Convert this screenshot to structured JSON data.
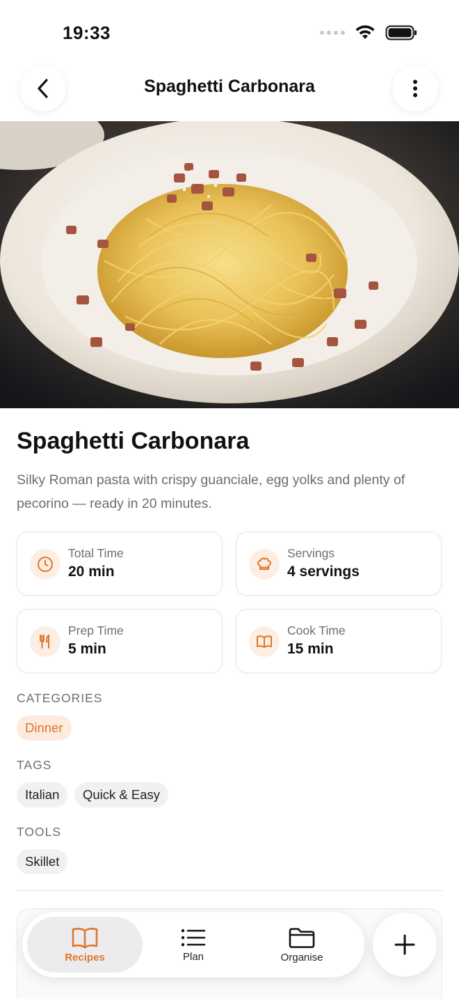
{
  "status_bar": {
    "time": "19:33"
  },
  "nav": {
    "title": "Spaghetti Carbonara"
  },
  "recipe": {
    "title": "Spaghetti Carbonara",
    "description": "Silky Roman pasta with crispy guanciale, egg yolks and plenty of pecorino — ready in 20 minutes."
  },
  "info": {
    "total_time": {
      "label": "Total Time",
      "value": "20 min"
    },
    "servings": {
      "label": "Servings",
      "value": "4 servings"
    },
    "prep_time": {
      "label": "Prep Time",
      "value": "5 min"
    },
    "cook_time": {
      "label": "Cook Time",
      "value": "15 min"
    }
  },
  "sections": {
    "categories": {
      "label": "CATEGORIES",
      "items": [
        "Dinner"
      ]
    },
    "tags": {
      "label": "TAGS",
      "items": [
        "Italian",
        "Quick & Easy"
      ]
    },
    "tools": {
      "label": "TOOLS",
      "items": [
        "Skillet"
      ]
    }
  },
  "tab_bar": {
    "tabs": [
      {
        "label": "Recipes",
        "icon": "book-icon",
        "active": true
      },
      {
        "label": "Plan",
        "icon": "list-icon",
        "active": false
      },
      {
        "label": "Organise",
        "icon": "folder-icon",
        "active": false
      }
    ]
  },
  "colors": {
    "accent": "#e0752a",
    "accent_soft": "#fdebe0",
    "chip_bg": "#f1f1f2",
    "text_secondary": "#6f6f74"
  }
}
